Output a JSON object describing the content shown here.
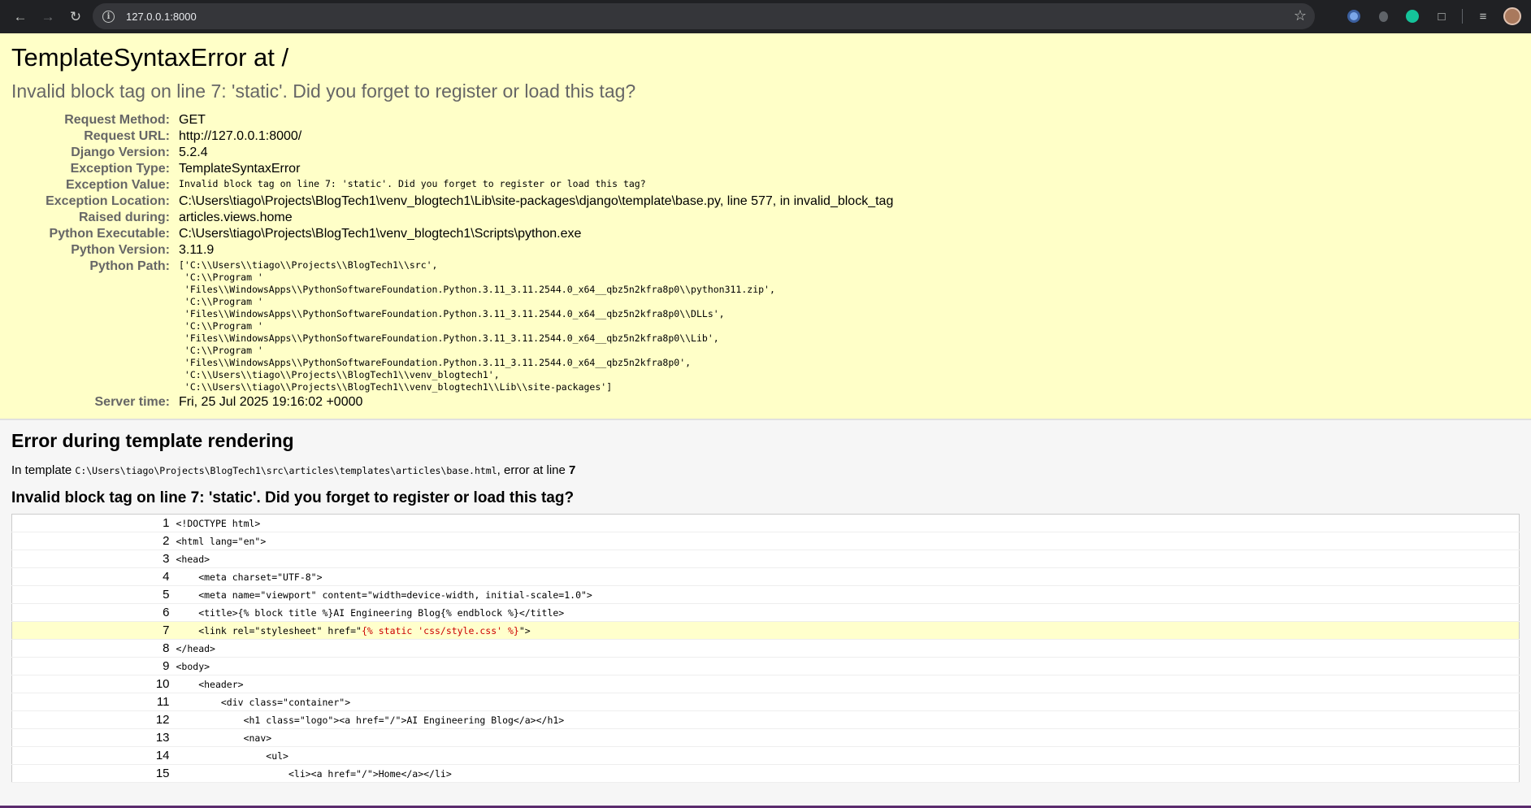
{
  "browser": {
    "url": "127.0.0.1:8000",
    "icons": [
      "back-arrow-icon",
      "forward-arrow-icon",
      "reload-icon",
      "site-info-icon",
      "bookmark-star-icon",
      "extensions-icon",
      "reading-list-icon",
      "profile-avatar"
    ]
  },
  "summary": {
    "title": "TemplateSyntaxError at /",
    "value": "Invalid block tag on line 7: 'static'. Did you forget to register or load this tag?",
    "rows": [
      {
        "label": "Request Method:",
        "value": "GET"
      },
      {
        "label": "Request URL:",
        "value": "http://127.0.0.1:8000/"
      },
      {
        "label": "Django Version:",
        "value": "5.2.4"
      },
      {
        "label": "Exception Type:",
        "value": "TemplateSyntaxError"
      },
      {
        "label": "Exception Value:",
        "value": "Invalid block tag on line 7: 'static'. Did you forget to register or load this tag?"
      },
      {
        "label": "Exception Location:",
        "value": "C:\\Users\\tiago\\Projects\\BlogTech1\\venv_blogtech1\\Lib\\site-packages\\django\\template\\base.py, line 577, in invalid_block_tag"
      },
      {
        "label": "Raised during:",
        "value": "articles.views.home"
      },
      {
        "label": "Python Executable:",
        "value": "C:\\Users\\tiago\\Projects\\BlogTech1\\venv_blogtech1\\Scripts\\python.exe"
      },
      {
        "label": "Python Version:",
        "value": "3.11.9"
      },
      {
        "label": "Python Path:",
        "value": "['C:\\\\Users\\\\tiago\\\\Projects\\\\BlogTech1\\\\src',\n 'C:\\\\Program '\n 'Files\\\\WindowsApps\\\\PythonSoftwareFoundation.Python.3.11_3.11.2544.0_x64__qbz5n2kfra8p0\\\\python311.zip',\n 'C:\\\\Program '\n 'Files\\\\WindowsApps\\\\PythonSoftwareFoundation.Python.3.11_3.11.2544.0_x64__qbz5n2kfra8p0\\\\DLLs',\n 'C:\\\\Program '\n 'Files\\\\WindowsApps\\\\PythonSoftwareFoundation.Python.3.11_3.11.2544.0_x64__qbz5n2kfra8p0\\\\Lib',\n 'C:\\\\Program '\n 'Files\\\\WindowsApps\\\\PythonSoftwareFoundation.Python.3.11_3.11.2544.0_x64__qbz5n2kfra8p0',\n 'C:\\\\Users\\\\tiago\\\\Projects\\\\BlogTech1\\\\venv_blogtech1',\n 'C:\\\\Users\\\\tiago\\\\Projects\\\\BlogTech1\\\\venv_blogtech1\\\\Lib\\\\site-packages']"
      },
      {
        "label": "Server time:",
        "value": "Fri, 25 Jul 2025 19:16:02 +0000"
      }
    ]
  },
  "template": {
    "heading": "Error during template rendering",
    "in_template_prefix": "In template ",
    "template_path": "C:\\Users\\tiago\\Projects\\BlogTech1\\src\\articles\\templates\\articles\\base.html",
    "error_at_line_text": ", error at line ",
    "error_line": "7",
    "message": "Invalid block tag on line 7: 'static'. Did you forget to register or load this tag?",
    "lines": [
      {
        "num": "1",
        "code": "<!DOCTYPE html>"
      },
      {
        "num": "2",
        "code": "<html lang=\"en\">"
      },
      {
        "num": "3",
        "code": "<head>"
      },
      {
        "num": "4",
        "code": "    <meta charset=\"UTF-8\">"
      },
      {
        "num": "5",
        "code": "    <meta name=\"viewport\" content=\"width=device-width, initial-scale=1.0\">"
      },
      {
        "num": "6",
        "code": "    <title>{% block title %}AI Engineering Blog{% endblock %}</title>"
      },
      {
        "num": "7",
        "code_before": "    <link rel=\"stylesheet\" href=\"",
        "code_error": "{% static 'css/style.css' %}",
        "code_after": "\">"
      },
      {
        "num": "8",
        "code": "</head>"
      },
      {
        "num": "9",
        "code": "<body>"
      },
      {
        "num": "10",
        "code": "    <header>"
      },
      {
        "num": "11",
        "code": "        <div class=\"container\">"
      },
      {
        "num": "12",
        "code": "            <h1 class=\"logo\"><a href=\"/\">AI Engineering Blog</a></h1>"
      },
      {
        "num": "13",
        "code": "            <nav>"
      },
      {
        "num": "14",
        "code": "                <ul>"
      },
      {
        "num": "15",
        "code": "                    <li><a href=\"/\">Home</a></li>"
      }
    ]
  }
}
